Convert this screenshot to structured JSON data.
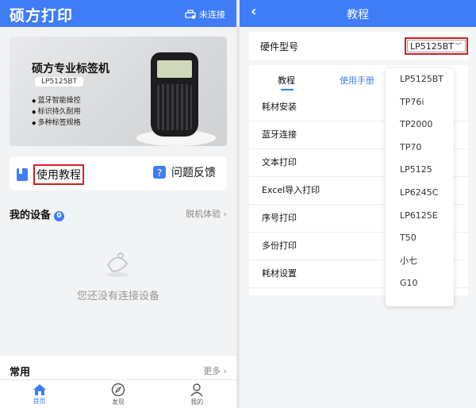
{
  "left": {
    "title": "硕方打印",
    "connection": "未连接",
    "banner": {
      "title": "硕方专业标签机",
      "model": "LP5125BT",
      "features": [
        "蓝牙智能操控",
        "标识持久耐用",
        "多种标签规格"
      ]
    },
    "actions": {
      "tutorial": "使用教程",
      "feedback": "问题反馈"
    },
    "devices": {
      "title": "我的设备",
      "count": "0",
      "offline": "脱机体验",
      "empty": "您还没有连接设备"
    },
    "common": {
      "title": "常用",
      "more": "更多"
    },
    "tabs": [
      {
        "label": "首页",
        "icon": "home-icon"
      },
      {
        "label": "发现",
        "icon": "compass-icon"
      },
      {
        "label": "我的",
        "icon": "user-icon"
      }
    ],
    "accent": "#3f7df7"
  },
  "right": {
    "title": "教程",
    "hardware_label": "硬件型号",
    "hardware_value": "LP5125BT",
    "tabs": {
      "tutorial": "教程",
      "manual": "使用手册"
    },
    "items": [
      "耗材安装",
      "蓝牙连接",
      "文本打印",
      "Excel导入打印",
      "序号打印",
      "多份打印",
      "耗材设置"
    ],
    "options": [
      "LP5125BT",
      "TP76i",
      "TP2000",
      "TP70",
      "LP5125",
      "LP6245C",
      "LP6125E",
      "T50",
      "小七",
      "G10"
    ],
    "highlight": "#d21f1f"
  }
}
